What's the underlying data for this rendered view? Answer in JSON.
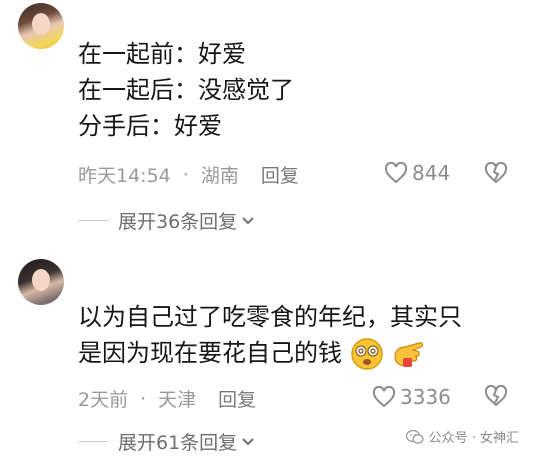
{
  "comments": [
    {
      "lines": [
        "在一起前：好爱",
        "在一起后：没感觉了",
        "分手后：好爱"
      ],
      "time": "昨天14:54",
      "location": "湖南",
      "reply_label": "回复",
      "likes": "844",
      "expand_label": "展开36条回复"
    },
    {
      "lines": [
        "以为自己过了吃零食的年纪，其实只",
        "是因为现在要花自己的钱"
      ],
      "time": "2天前",
      "location": "天津",
      "reply_label": "回复",
      "likes": "3336",
      "expand_label": "展开61条回复"
    }
  ],
  "meta_separator": "·",
  "watermark": "公众号 · 女神汇",
  "icons": [
    "heart-icon",
    "dislike-heart-icon",
    "chevron-down-icon",
    "dizzy-face-emoji",
    "pointing-hand-emoji",
    "wechat-icon"
  ]
}
